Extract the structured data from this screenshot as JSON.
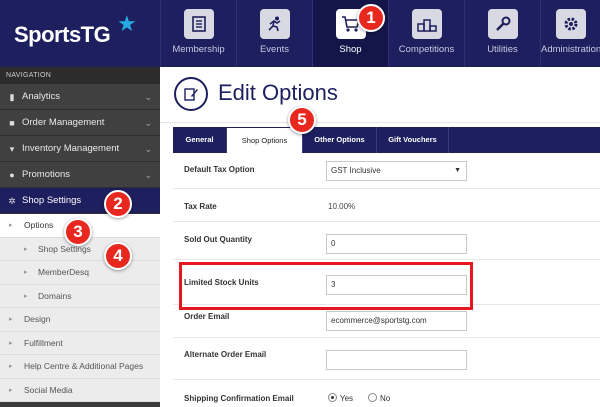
{
  "brand": {
    "logo_text": "SportsTG"
  },
  "topnav": {
    "items": [
      {
        "label": "Membership",
        "icon": "membership-icon",
        "active": false
      },
      {
        "label": "Events",
        "icon": "events-icon",
        "active": false
      },
      {
        "label": "Shop",
        "icon": "cart-icon",
        "active": true
      },
      {
        "label": "Competitions",
        "icon": "podium-icon",
        "active": false
      },
      {
        "label": "Utilities",
        "icon": "wrench-icon",
        "active": false
      },
      {
        "label": "Administration",
        "icon": "gear-icon",
        "active": false
      }
    ]
  },
  "sidebar": {
    "header": "NAVIGATION",
    "items": [
      {
        "label": "Analytics",
        "icon": "bar-chart-icon"
      },
      {
        "label": "Order Management",
        "icon": "truck-icon"
      },
      {
        "label": "Inventory Management",
        "icon": "cart-icon"
      },
      {
        "label": "Promotions",
        "icon": "circle-icon"
      },
      {
        "label": "Shop Settings",
        "icon": "cogs-icon",
        "active": true
      }
    ],
    "subitems": [
      {
        "label": "Options",
        "level": 1,
        "selected": true
      },
      {
        "label": "Shop Settings",
        "level": 2
      },
      {
        "label": "MemberDesq",
        "level": 2
      },
      {
        "label": "Domains",
        "level": 2
      },
      {
        "label": "Design",
        "level": 1
      },
      {
        "label": "Fulfillment",
        "level": 1
      },
      {
        "label": "Help Centre & Additional Pages",
        "level": 1
      },
      {
        "label": "Social Media",
        "level": 1
      }
    ]
  },
  "page": {
    "title": "Edit Options"
  },
  "tabs": [
    "General",
    "Shop Options",
    "Other Options",
    "Gift Vouchers"
  ],
  "form": {
    "default_tax_label": "Default Tax Option",
    "default_tax_value": "GST Inclusive",
    "tax_rate_label": "Tax Rate",
    "tax_rate_value": "10.00%",
    "sold_out_label": "Sold Out Quantity",
    "sold_out_value": "0",
    "limited_stock_label": "Limited Stock Units",
    "limited_stock_value": "3",
    "order_email_label": "Order Email",
    "order_email_value": "ecommerce@sportstg.com",
    "alt_order_email_label": "Alternate Order Email",
    "alt_order_email_value": "",
    "shipping_email_label": "Shipping Confirmation Email",
    "yes_label": "Yes",
    "no_label": "No"
  },
  "callouts": [
    "1",
    "2",
    "3",
    "4",
    "5"
  ],
  "colors": {
    "navy": "#1d1f5e",
    "callout_red": "#e8281f",
    "highlight_red": "#e8161f",
    "logo_star": "#27a9e1"
  }
}
